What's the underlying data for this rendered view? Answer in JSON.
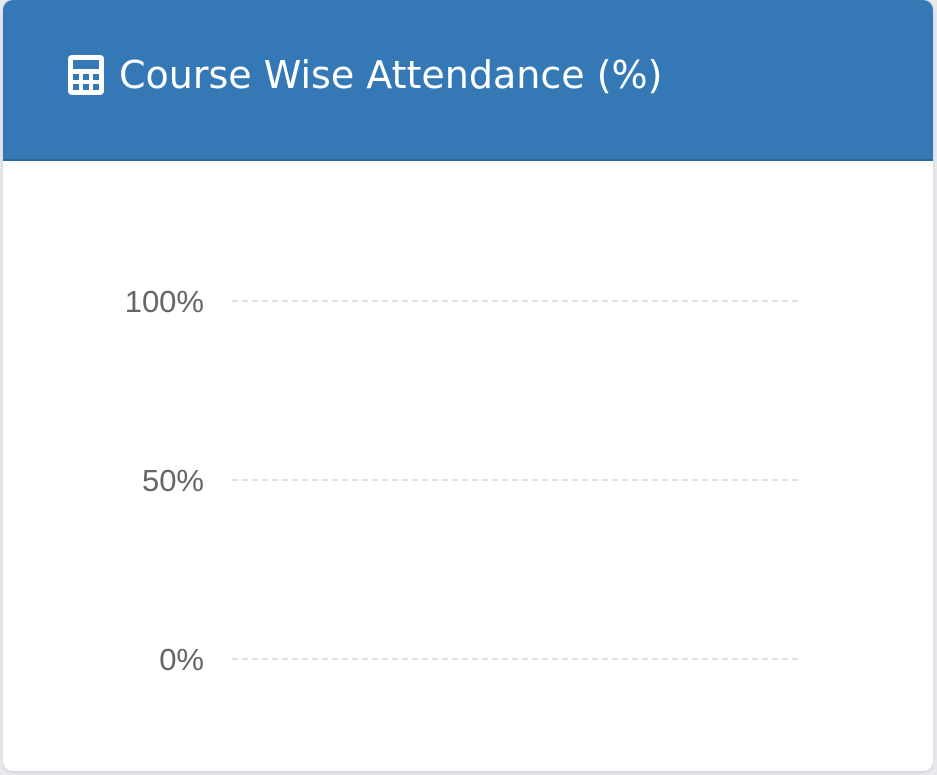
{
  "card": {
    "title": "Course Wise Attendance (%)",
    "icon": "calculator-icon",
    "header_color": "#3479b6"
  },
  "chart_data": {
    "type": "bar",
    "categories": [],
    "series": [],
    "ylim": [
      0,
      100
    ],
    "y_ticks": [
      {
        "value": 100,
        "label": "100%"
      },
      {
        "value": 50,
        "label": "50%"
      },
      {
        "value": 0,
        "label": "0%"
      }
    ],
    "grid": true,
    "grid_style": "dashed",
    "grid_color": "#dfe3e8"
  }
}
